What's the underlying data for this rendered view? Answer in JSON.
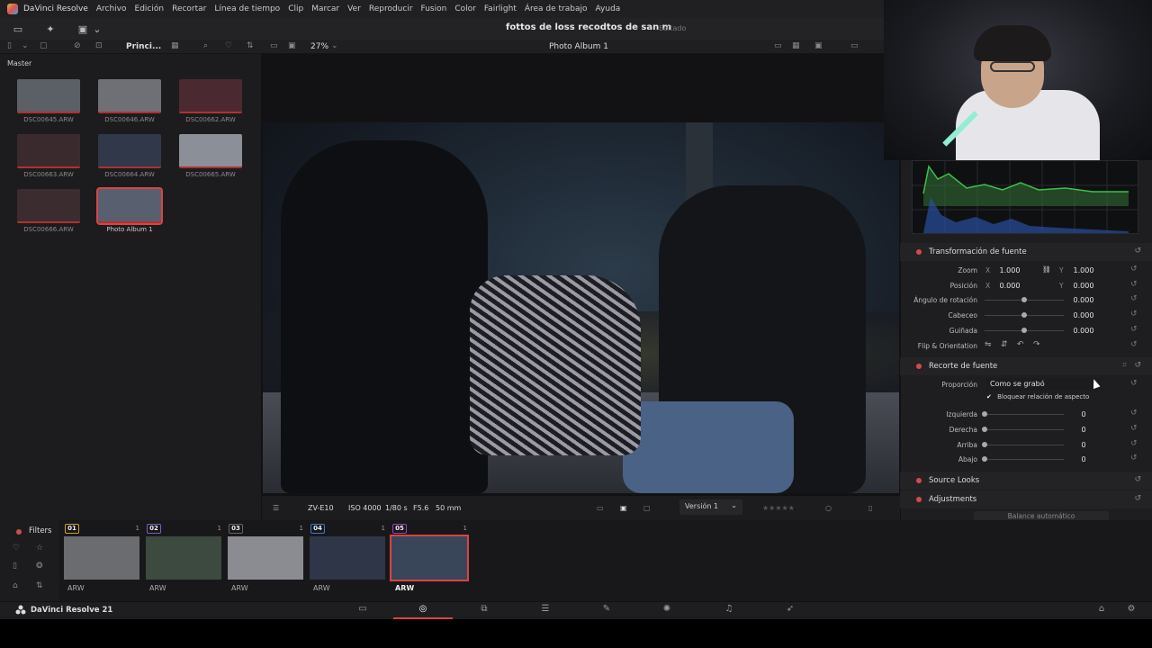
{
  "menu": {
    "app": "DaVinci Resolve",
    "items": [
      "Archivo",
      "Edición",
      "Recortar",
      "Línea de tiempo",
      "Clip",
      "Marcar",
      "Ver",
      "Reproducir",
      "Fusion",
      "Color",
      "Fairlight",
      "Área de trabajo",
      "Ayuda"
    ]
  },
  "header": {
    "project_title": "fottos de loss recodtos de san m",
    "status": "Editado"
  },
  "subbar": {
    "sort_label": "Princi...",
    "zoom": "27%",
    "album": "Photo Album 1"
  },
  "pool": {
    "title": "Master",
    "items": [
      {
        "name": "DSC00645.ARW",
        "color": "#5b5f66"
      },
      {
        "name": "DSC00646.ARW",
        "color": "#6e7075"
      },
      {
        "name": "DSC00662.ARW",
        "color": "#4a2a30"
      },
      {
        "name": "DSC00663.ARW",
        "color": "#3a2a2e"
      },
      {
        "name": "DSC00664.ARW",
        "color": "#31384a"
      },
      {
        "name": "DSC00665.ARW",
        "color": "#8a8f98"
      },
      {
        "name": "DSC00666.ARW",
        "color": "#3b2c30"
      },
      {
        "name": "Photo Album 1",
        "color": "#586070"
      }
    ]
  },
  "viewer_info": {
    "camera": "ZV-E10",
    "iso": "ISO 4000",
    "shutter": "1/80 s",
    "aperture": "F5.6",
    "focal": "50 mm",
    "version": "Versión 1"
  },
  "inspector": {
    "transform": {
      "title": "Transformación de fuente",
      "zoom_label": "Zoom",
      "zoom_x": "1.000",
      "zoom_y": "1.000",
      "pos_label": "Posición",
      "pos_x": "0.000",
      "pos_y": "0.000",
      "rotation_label": "Ángulo de rotación",
      "rotation": "0.000",
      "pitch_label": "Cabeceo",
      "pitch": "0.000",
      "yaw_label": "Guiñada",
      "yaw": "0.000",
      "flip_label": "Flip & Orientation",
      "x": "X",
      "y": "Y"
    },
    "crop": {
      "title": "Recorte de fuente",
      "ratio_label": "Proporción",
      "ratio_value": "Como se grabó",
      "lock_label": "Bloquear relación de aspecto",
      "left_label": "Izquierda",
      "left": "0",
      "right_label": "Derecha",
      "right": "0",
      "top_label": "Arriba",
      "top": "0",
      "bottom_label": "Abajo",
      "bottom": "0"
    },
    "source_looks": "Source Looks",
    "adjustments": "Adjustments",
    "auto_balance": "Balance automático"
  },
  "filmstrip": {
    "filters_label": "Filters",
    "clips": [
      {
        "num": "01",
        "count": "1",
        "type": "ARW",
        "badge": "#c9a227",
        "color": "#6a6c70"
      },
      {
        "num": "02",
        "count": "1",
        "type": "ARW",
        "badge": "#7a5ad0",
        "color": "#3c4a3f"
      },
      {
        "num": "03",
        "count": "1",
        "type": "ARW",
        "badge": "#666666",
        "color": "#8a8c92"
      },
      {
        "num": "04",
        "count": "1",
        "type": "ARW",
        "badge": "#3a7ad0",
        "color": "#2e3648"
      },
      {
        "num": "05",
        "count": "1",
        "type": "ARW",
        "badge": "#a040c0",
        "color": "#39465a"
      }
    ]
  },
  "pagebar": {
    "brand": "DaVinci Resolve 21",
    "pages": [
      "media",
      "cut",
      "edit",
      "fusion",
      "color",
      "fairlight",
      "deliver"
    ]
  }
}
